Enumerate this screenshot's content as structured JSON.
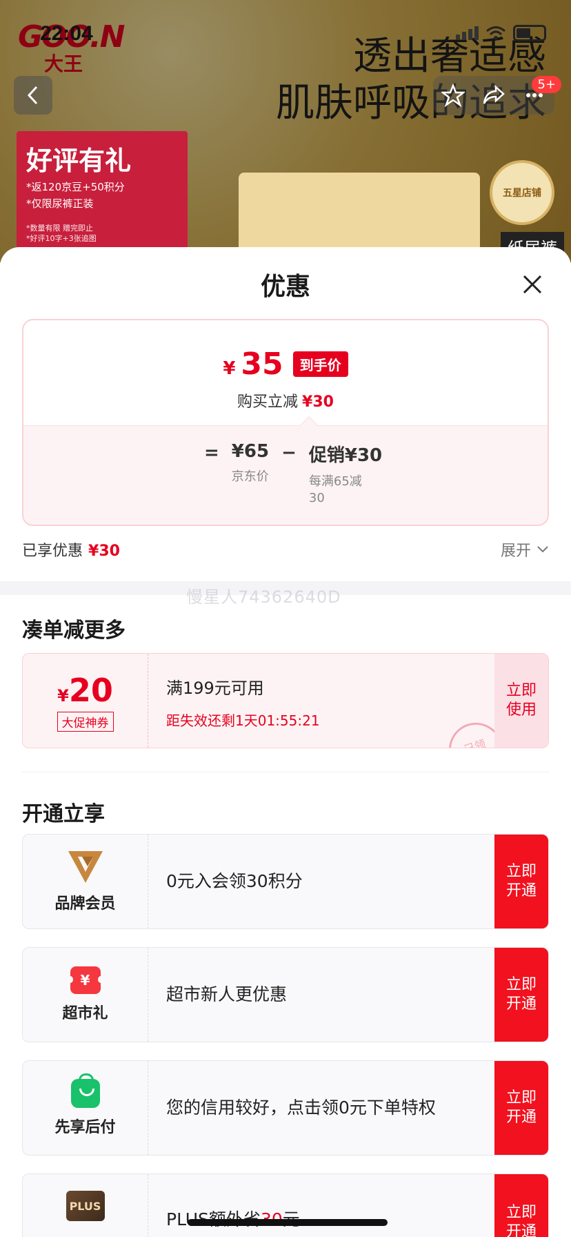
{
  "status_bar": {
    "time": "22:04"
  },
  "background": {
    "brand": {
      "name": "GOO.N",
      "sub": "大王"
    },
    "headline": [
      "透出奢适感",
      "肌肤呼吸的追求"
    ],
    "message_badge": "5+",
    "promo": {
      "title": "好评有礼",
      "line1": "*返120京豆+50积分",
      "line2": "*仅限尿裤正装",
      "fine1": "*数量有限 赠完即止",
      "fine2": "*好评10字+3张追图"
    },
    "store_badge": "五星店铺",
    "side_tag": "纸尿裤"
  },
  "watermark": "慢星人74362640D",
  "sheet": {
    "title": "优惠",
    "price_card": {
      "currency": "¥",
      "final_price": "35",
      "final_tag": "到手价",
      "reduce_label": "购买立减",
      "reduce_value": "¥30",
      "equals": "=",
      "minus": "−",
      "jd_price": "¥65",
      "jd_price_label": "京东价",
      "promo_value": "促销¥30",
      "promo_desc_1": "每满65减",
      "promo_desc_2": "30"
    },
    "enjoyed": {
      "label": "已享优惠",
      "value": "¥30",
      "expand": "展开"
    },
    "more_section": {
      "title": "凑单减更多",
      "coupon": {
        "currency": "¥",
        "amount": "20",
        "tag": "大促神券",
        "condition": "满199元可用",
        "countdown": "距失效还剩1天01:55:21",
        "action_line1": "立即",
        "action_line2": "使用",
        "stamp": "已领"
      }
    },
    "open_section": {
      "title": "开通立享",
      "items": [
        {
          "icon": "brand-member-v-icon",
          "name": "品牌会员",
          "desc": "0元入会领30积分",
          "action_line1": "立即",
          "action_line2": "开通"
        },
        {
          "icon": "supermarket-gift-icon",
          "name": "超市礼",
          "desc": "超市新人更优惠",
          "action_line1": "立即",
          "action_line2": "开通"
        },
        {
          "icon": "pay-later-bag-icon",
          "name": "先享后付",
          "desc": "您的信用较好，点击领0元下单特权",
          "action_line1": "立即",
          "action_line2": "开通"
        },
        {
          "icon": "plus-icon",
          "name": "PLUS",
          "desc_prefix": "PLUS额外省",
          "desc_value": "30",
          "desc_suffix": "元",
          "action_line1": "立即",
          "action_line2": "开通"
        }
      ]
    }
  },
  "colors": {
    "accent_red": "#e6001f",
    "open_red": "#f1111f",
    "coupon_bg": "#fdf3f4"
  }
}
